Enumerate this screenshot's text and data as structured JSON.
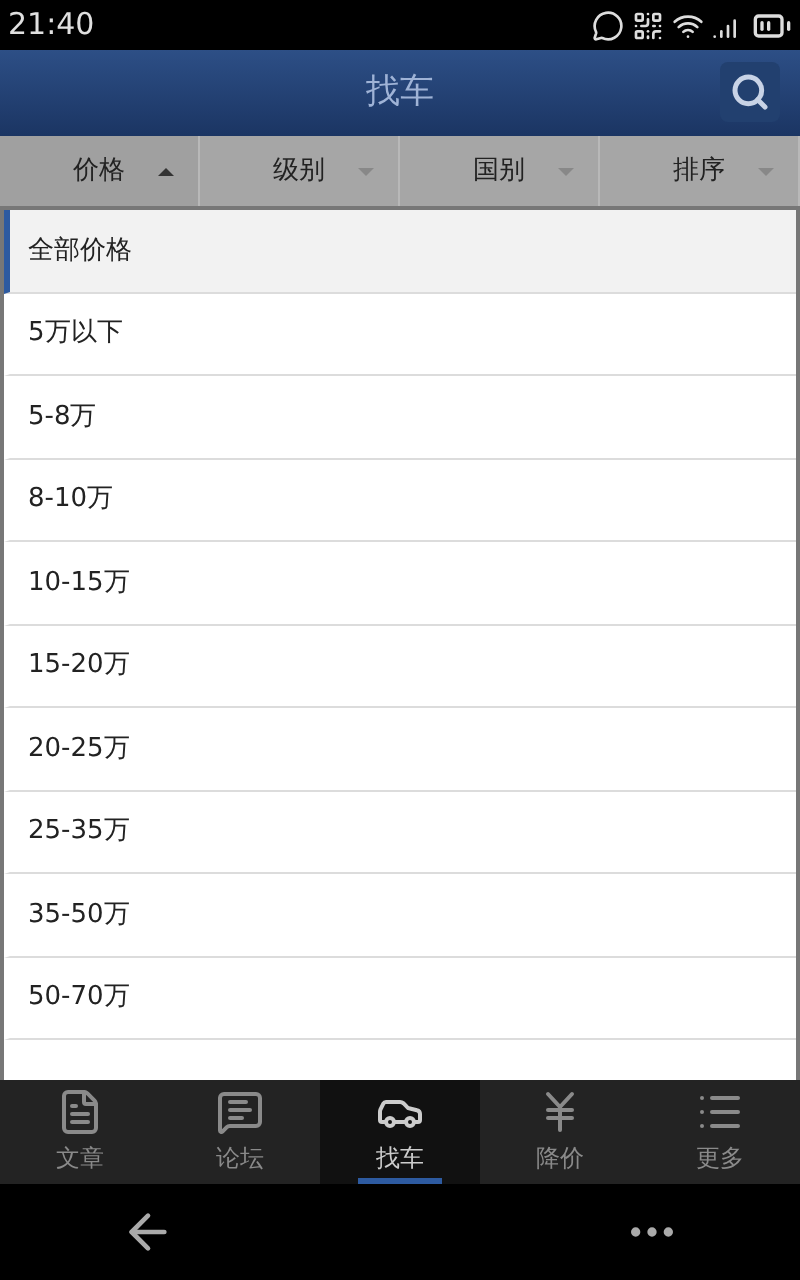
{
  "status_bar": {
    "time": "21:40"
  },
  "header": {
    "title": "找车"
  },
  "filters": [
    {
      "label": "价格",
      "expanded": true
    },
    {
      "label": "级别",
      "expanded": false
    },
    {
      "label": "国别",
      "expanded": false
    },
    {
      "label": "排序",
      "expanded": false
    }
  ],
  "price_options": [
    {
      "label": "全部价格",
      "selected": true
    },
    {
      "label": "5万以下",
      "selected": false
    },
    {
      "label": "5-8万",
      "selected": false
    },
    {
      "label": "8-10万",
      "selected": false
    },
    {
      "label": "10-15万",
      "selected": false
    },
    {
      "label": "15-20万",
      "selected": false
    },
    {
      "label": "20-25万",
      "selected": false
    },
    {
      "label": "25-35万",
      "selected": false
    },
    {
      "label": "35-50万",
      "selected": false
    },
    {
      "label": "50-70万",
      "selected": false
    }
  ],
  "tab_bar": [
    {
      "label": "文章",
      "kind": "article",
      "selected": false
    },
    {
      "label": "论坛",
      "kind": "forum",
      "selected": false
    },
    {
      "label": "找车",
      "kind": "findcar",
      "selected": true
    },
    {
      "label": "降价",
      "kind": "discount",
      "selected": false
    },
    {
      "label": "更多",
      "kind": "more",
      "selected": false
    }
  ]
}
